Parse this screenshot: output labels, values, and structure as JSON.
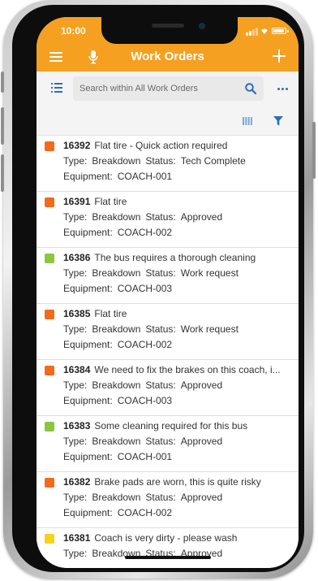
{
  "status_bar": {
    "time": "10:00"
  },
  "app_bar": {
    "title": "Work Orders",
    "menu_icon": "hamburger-menu-icon",
    "mic_icon": "microphone-icon",
    "add_icon": "plus-icon",
    "color": "#f5a020"
  },
  "search": {
    "placeholder": "Search within All Work Orders",
    "value": ""
  },
  "labels": {
    "type": "Type:",
    "status": "Status:",
    "equipment": "Equipment:"
  },
  "status_colors": {
    "orange": "#f26b1d",
    "green": "#8cc63f",
    "yellow": "#f7d21a"
  },
  "work_orders": [
    {
      "id": "16392",
      "title": "Flat tire - Quick action required",
      "type": "Breakdown",
      "status": "Tech Complete",
      "equipment": "COACH-001",
      "color": "orange"
    },
    {
      "id": "16391",
      "title": "Flat tire",
      "type": "Breakdown",
      "status": "Approved",
      "equipment": "COACH-002",
      "color": "orange"
    },
    {
      "id": "16386",
      "title": "The bus requires a thorough cleaning",
      "type": "Breakdown",
      "status": "Work request",
      "equipment": "COACH-003",
      "color": "green"
    },
    {
      "id": "16385",
      "title": "Flat tire",
      "type": "Breakdown",
      "status": "Work request",
      "equipment": "COACH-002",
      "color": "orange"
    },
    {
      "id": "16384",
      "title": "We need to fix the brakes on this coach, i...",
      "type": "Breakdown",
      "status": "Approved",
      "equipment": "COACH-003",
      "color": "orange"
    },
    {
      "id": "16383",
      "title": "Some cleaning required for this bus",
      "type": "Breakdown",
      "status": "Approved",
      "equipment": "COACH-001",
      "color": "green"
    },
    {
      "id": "16382",
      "title": "Brake pads are worn, this is quite risky",
      "type": "Breakdown",
      "status": "Approved",
      "equipment": "COACH-002",
      "color": "orange"
    },
    {
      "id": "16381",
      "title": "Coach is very dirty - please wash",
      "type": "Breakdown",
      "status": "Approved",
      "equipment": "",
      "color": "yellow"
    }
  ]
}
